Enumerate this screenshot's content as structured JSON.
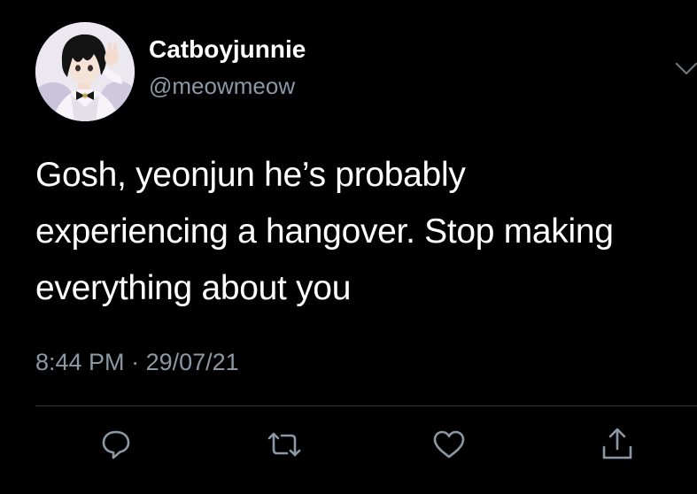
{
  "tweet": {
    "author_name": "Catboyjunnie",
    "author_handle": "@meowmeow",
    "text_lines": [
      "Gosh, yeonjun he’s probably",
      "experiencing a hangover. Stop making",
      "everything about you"
    ],
    "time": "8:44 PM",
    "separator": "·",
    "date": "29/07/21"
  },
  "icons": {
    "menu": "chevron-down-icon",
    "reply": "reply-icon",
    "retweet": "retweet-icon",
    "like": "heart-icon",
    "share": "share-icon",
    "avatar": "avatar-image"
  },
  "colors": {
    "background": "#000000",
    "primary_text": "#ffffff",
    "secondary_text": "#8b98a5",
    "divider": "#2f3336"
  }
}
